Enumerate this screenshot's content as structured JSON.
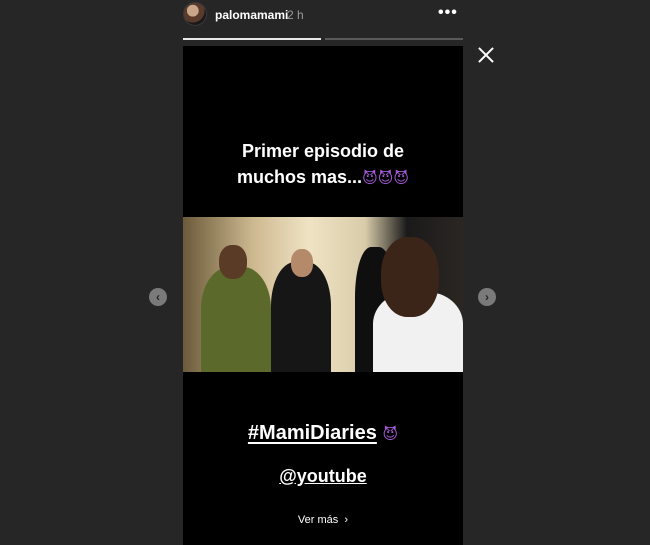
{
  "header": {
    "username": "palomamami",
    "time": "2 h",
    "more": "•••"
  },
  "progress": {
    "segments": 2,
    "current": 1
  },
  "story": {
    "caption_line1": "Primer episodio de",
    "caption_line2": "muchos mas...",
    "caption_emojis": "😈😈😈",
    "hashtag": "#MamiDiaries",
    "hashtag_emoji": "😈",
    "mention": "@youtube",
    "see_more": "Ver más",
    "see_more_icon": "›"
  },
  "nav": {
    "prev_icon": "‹",
    "next_icon": "›"
  },
  "colors": {
    "background": "#262626",
    "story_background": "#000000",
    "emoji_purple": "#a45ad6"
  },
  "icons": [
    "avatar",
    "more-options-icon",
    "close-icon",
    "chevron-left-icon",
    "chevron-right-icon"
  ]
}
